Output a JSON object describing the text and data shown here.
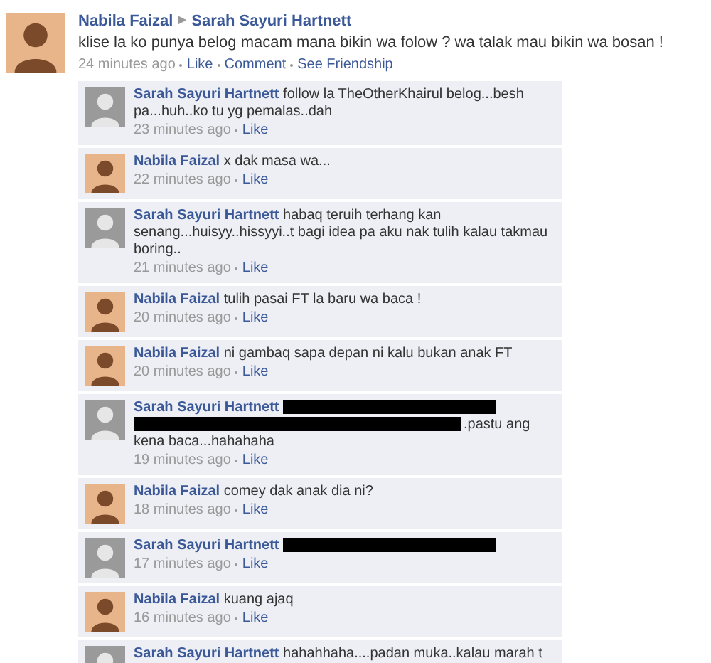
{
  "post": {
    "kind": "color",
    "author": "Nabila Faizal",
    "separator": "▶",
    "target": "Sarah Sayuri Hartnett",
    "text": "klise la ko punya belog macam mana bikin wa folow ? wa talak mau bikin wa bosan !",
    "time": "24 minutes ago",
    "actions": [
      "Like",
      "Comment",
      "See Friendship"
    ]
  },
  "comments": [
    {
      "kind": "gray",
      "author": "Sarah Sayuri Hartnett",
      "parts": [
        {
          "kind": "text",
          "text": "follow la TheOtherKhairul belog...besh pa...huh..ko tu yg pemalas..dah"
        }
      ],
      "time": "23 minutes ago",
      "action": "Like"
    },
    {
      "kind": "color",
      "author": "Nabila Faizal",
      "parts": [
        {
          "kind": "text",
          "text": "x dak masa wa..."
        }
      ],
      "time": "22 minutes ago",
      "action": "Like"
    },
    {
      "kind": "gray",
      "author": "Sarah Sayuri Hartnett",
      "parts": [
        {
          "kind": "text",
          "text": "habaq teruih terhang kan senang...huisyy..hissyyi..t bagi idea pa aku nak tulih kalau takmau boring.."
        }
      ],
      "time": "21 minutes ago",
      "action": "Like"
    },
    {
      "kind": "color",
      "author": "Nabila Faizal",
      "parts": [
        {
          "kind": "text",
          "text": "tulih pasai FT la baru wa baca !"
        }
      ],
      "time": "20 minutes ago",
      "action": "Like"
    },
    {
      "kind": "color",
      "author": "Nabila Faizal",
      "parts": [
        {
          "kind": "text",
          "text": "ni gambaq sapa depan ni kalu bukan anak FT"
        }
      ],
      "time": "20 minutes ago",
      "action": "Like"
    },
    {
      "kind": "gray",
      "author": "Sarah Sayuri Hartnett",
      "parts": [
        {
          "kind": "redaction"
        },
        {
          "kind": "redaction"
        },
        {
          "kind": "text",
          "text": ".pastu ang kena baca...hahahaha"
        }
      ],
      "time": "19 minutes ago",
      "action": "Like"
    },
    {
      "kind": "color",
      "author": "Nabila Faizal",
      "parts": [
        {
          "kind": "text",
          "text": "comey dak anak dia ni?"
        }
      ],
      "time": "18 minutes ago",
      "action": "Like"
    },
    {
      "kind": "gray",
      "author": "Sarah Sayuri Hartnett",
      "parts": [
        {
          "kind": "redaction"
        }
      ],
      "time": "17 minutes ago",
      "action": "Like"
    },
    {
      "kind": "color",
      "author": "Nabila Faizal",
      "parts": [
        {
          "kind": "text",
          "text": "kuang ajaq"
        }
      ],
      "time": "16 minutes ago",
      "action": "Like"
    },
    {
      "kind": "gray",
      "author": "Sarah Sayuri Hartnett",
      "parts": [
        {
          "kind": "text",
          "text": "hahahhaha....padan muka..kalau marah t"
        }
      ]
    }
  ]
}
